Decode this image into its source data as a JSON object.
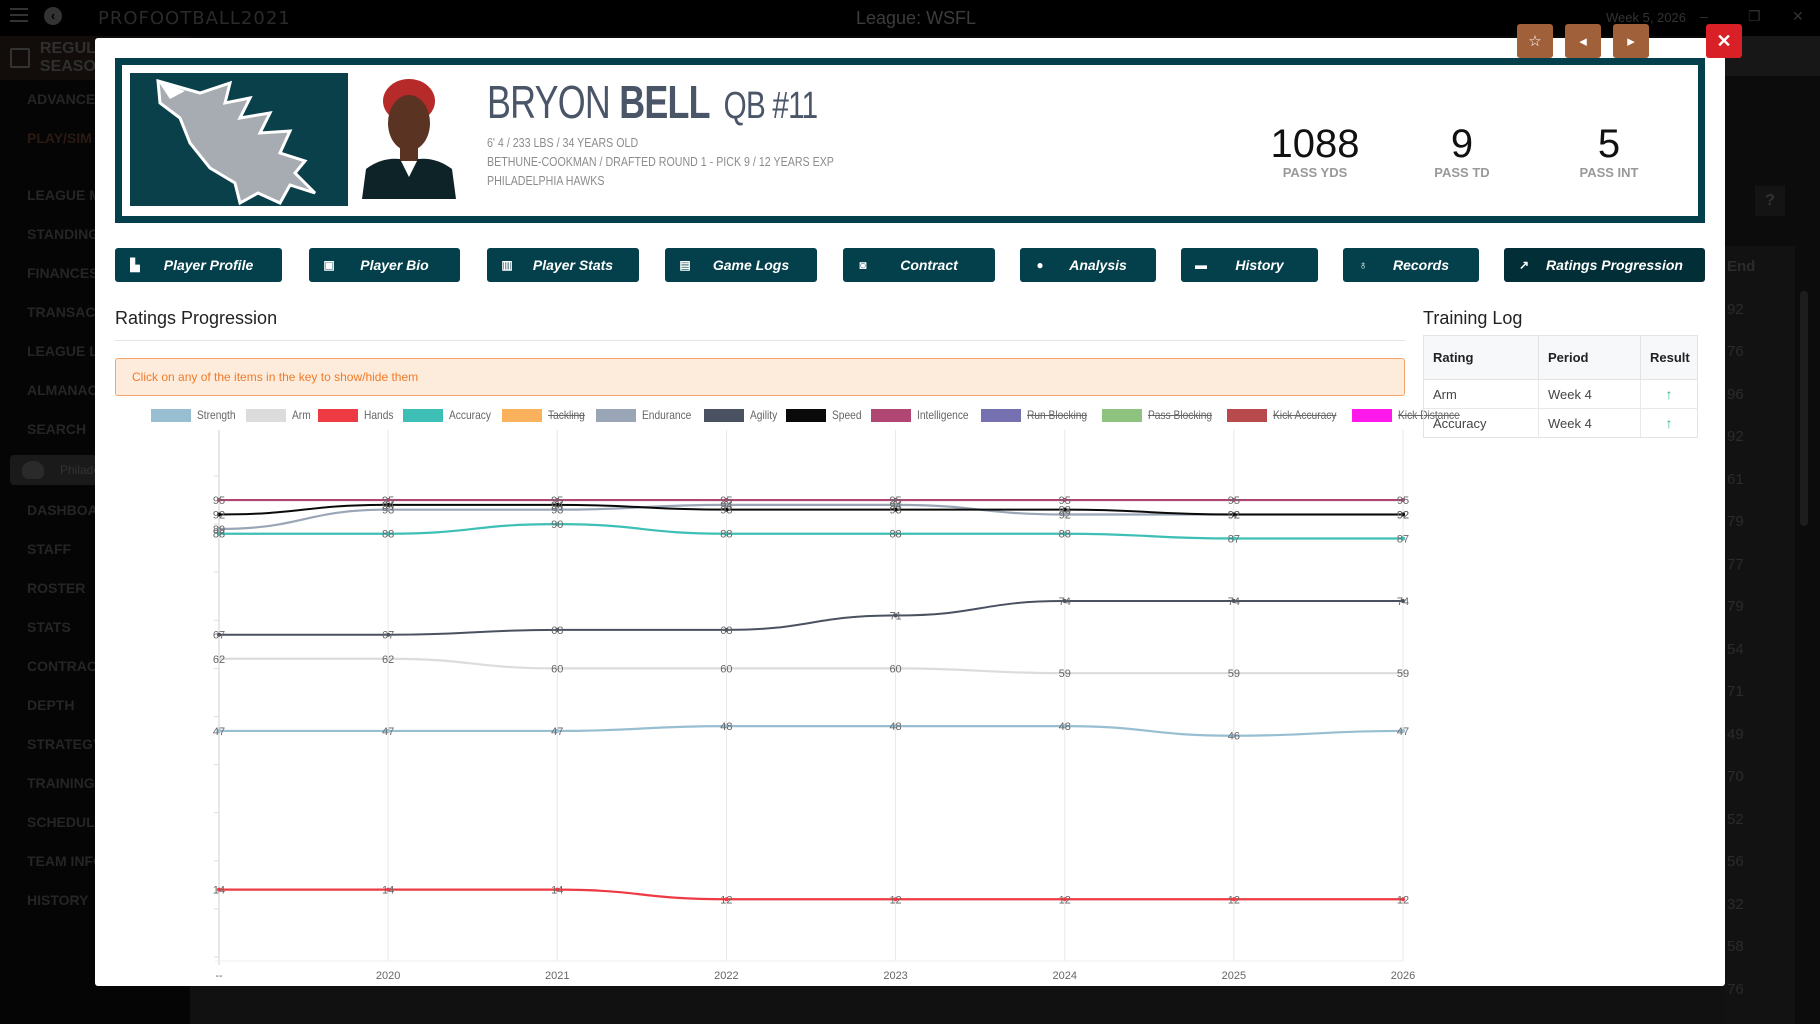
{
  "app": {
    "brand": "PROFOOTBALL2021",
    "league_title": "League: WSFL",
    "week": "Week 5, 2026",
    "season_label": "REGULAR SEASON",
    "sidebar": {
      "top_items": [
        {
          "label": "ADVANCE"
        },
        {
          "label": "PLAY/SIM"
        }
      ],
      "league_items": [
        {
          "label": "LEAGUE MENU"
        },
        {
          "label": "STANDINGS"
        },
        {
          "label": "FINANCES"
        },
        {
          "label": "TRANSACTIONS"
        },
        {
          "label": "LEAGUE LEADERS"
        },
        {
          "label": "ALMANAC"
        },
        {
          "label": "SEARCH"
        }
      ],
      "team_pill": "Philadelphia",
      "team_items": [
        {
          "label": "DASHBOARD"
        },
        {
          "label": "STAFF"
        },
        {
          "label": "ROSTER"
        },
        {
          "label": "STATS"
        },
        {
          "label": "CONTRACTS"
        },
        {
          "label": "DEPTH"
        },
        {
          "label": "STRATEGY"
        },
        {
          "label": "TRAINING"
        },
        {
          "label": "SCHEDULE"
        },
        {
          "label": "TEAM INFO"
        },
        {
          "label": "HISTORY"
        }
      ]
    },
    "background_column": {
      "header": "End",
      "values": [
        "92",
        "76",
        "96",
        "92",
        "61",
        "79",
        "77",
        "79",
        "54",
        "71",
        "49",
        "70",
        "52",
        "56",
        "32",
        "58",
        "76"
      ]
    }
  },
  "modal": {
    "tools": [
      {
        "name": "favorite",
        "icon": "star-icon",
        "glyph": "☆"
      },
      {
        "name": "previous",
        "icon": "caret-left-icon",
        "glyph": "◂"
      },
      {
        "name": "next",
        "icon": "caret-right-icon",
        "glyph": "▸"
      }
    ],
    "close_glyph": "✕",
    "player": {
      "first_name": "BRYON",
      "last_name": "BELL",
      "position_number": "QB #11",
      "line1": "6' 4 / 233 LBS / 34 YEARS OLD",
      "line2": "BETHUNE-COOKMAN / DRAFTED ROUND 1 - PICK 9 / 12 YEARS EXP",
      "line3": "PHILADELPHIA HAWKS"
    },
    "stats": [
      {
        "value": "1088",
        "label": "PASS YDS"
      },
      {
        "value": "9",
        "label": "PASS TD"
      },
      {
        "value": "5",
        "label": "PASS INT"
      }
    ],
    "tabs": [
      {
        "label": "Player Profile",
        "icon": "reader-icon",
        "glyph": "▙"
      },
      {
        "label": "Player Bio",
        "icon": "id-badge-icon",
        "glyph": "▣"
      },
      {
        "label": "Player Stats",
        "icon": "bar-chart-icon",
        "glyph": "▥"
      },
      {
        "label": "Game Logs",
        "icon": "clipboard-icon",
        "glyph": "▤"
      },
      {
        "label": "Contract",
        "icon": "money-icon",
        "glyph": "◙"
      },
      {
        "label": "Analysis",
        "icon": "info-circle-icon",
        "glyph": "●"
      },
      {
        "label": "History",
        "icon": "archive-icon",
        "glyph": "▬"
      },
      {
        "label": "Records",
        "icon": "award-icon",
        "glyph": "♁"
      },
      {
        "label": "Ratings Progression",
        "icon": "line-chart-icon",
        "glyph": "↗"
      }
    ],
    "ratings_title": "Ratings Progression",
    "alert_text": "Click on any of the items in the key to show/hide them",
    "training_log": {
      "title": "Training Log",
      "columns": [
        "Rating",
        "Period",
        "Result"
      ],
      "rows": [
        {
          "rating": "Arm",
          "period": "Week 4",
          "result": "up",
          "glyph": "🡑"
        },
        {
          "rating": "Accuracy",
          "period": "Week 4",
          "result": "up",
          "glyph": "🡑"
        }
      ]
    }
  },
  "chart_data": {
    "type": "line",
    "title": "Ratings Progression",
    "xlabel": "",
    "ylabel": "",
    "x": [
      "--",
      "2020",
      "2021",
      "2022",
      "2023",
      "2024",
      "2025",
      "2026"
    ],
    "ylim": [
      0,
      100
    ],
    "grid": true,
    "legend_position": "top",
    "series": [
      {
        "name": "Strength",
        "color": "#98bed2",
        "visible": true,
        "values": [
          47,
          47,
          47,
          48,
          48,
          48,
          46,
          47
        ]
      },
      {
        "name": "Arm",
        "color": "#dcdcdc",
        "visible": true,
        "values": [
          62,
          62,
          60,
          60,
          60,
          59,
          59,
          59
        ]
      },
      {
        "name": "Hands",
        "color": "#ee3a43",
        "visible": true,
        "values": [
          14,
          14,
          14,
          12,
          12,
          12,
          12,
          12
        ]
      },
      {
        "name": "Accuracy",
        "color": "#3ebfb6",
        "visible": true,
        "values": [
          88,
          88,
          90,
          88,
          88,
          88,
          87,
          87
        ]
      },
      {
        "name": "Tackling",
        "color": "#f9b15c",
        "visible": false,
        "values": []
      },
      {
        "name": "Endurance",
        "color": "#9aa5b5",
        "visible": true,
        "values": [
          89,
          93,
          93,
          94,
          94,
          92,
          92,
          92
        ]
      },
      {
        "name": "Agility",
        "color": "#4a5160",
        "visible": true,
        "values": [
          67,
          67,
          68,
          68,
          71,
          74,
          74,
          74
        ]
      },
      {
        "name": "Speed",
        "color": "#0a0a0a",
        "visible": true,
        "values": [
          92,
          94,
          94,
          93,
          93,
          93,
          92,
          92
        ]
      },
      {
        "name": "Intelligence",
        "color": "#b04772",
        "visible": true,
        "values": [
          95,
          95,
          95,
          95,
          95,
          95,
          95,
          95
        ]
      },
      {
        "name": "Run Blocking",
        "color": "#7571b0",
        "visible": false,
        "values": []
      },
      {
        "name": "Pass Blocking",
        "color": "#8dc27f",
        "visible": false,
        "values": []
      },
      {
        "name": "Kick Accuracy",
        "color": "#b84a4d",
        "visible": false,
        "values": []
      },
      {
        "name": "Kick Distance",
        "color": "#ff19ea",
        "visible": false,
        "values": []
      }
    ]
  }
}
